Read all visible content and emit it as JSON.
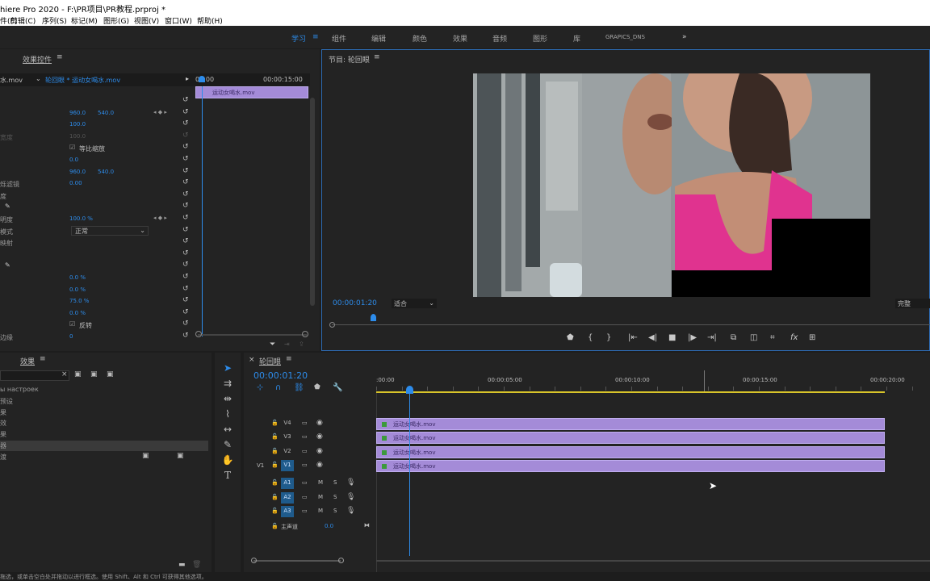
{
  "app": {
    "title": "hiere Pro 2020 - F:\\PR项目\\PR教程.prproj *"
  },
  "menu": [
    "件(F)",
    "剪辑(C)",
    "序列(S)",
    "标记(M)",
    "图形(G)",
    "视图(V)",
    "窗口(W)",
    "帮助(H)"
  ],
  "workspaces": [
    {
      "label": "学习",
      "active": true
    },
    {
      "label": "组件"
    },
    {
      "label": "编辑"
    },
    {
      "label": "颜色"
    },
    {
      "label": "效果"
    },
    {
      "label": "音频"
    },
    {
      "label": "图形"
    },
    {
      "label": "库"
    },
    {
      "label": "GRAPICS_DNS"
    }
  ],
  "effect_controls": {
    "tab": "效果控件",
    "source": "水.mov",
    "clip": "轮回眼 * 运动女喝水.mov",
    "ruler": [
      "00:00",
      "00:00:15:00"
    ],
    "clip_label": "运动女喝水.mov",
    "rows": [
      {
        "label": "",
        "v1": "",
        "v2": ""
      },
      {
        "label": "",
        "v1": "960.0",
        "v2": "540.0",
        "kf": true
      },
      {
        "label": "",
        "v1": "100.0",
        "v2": ""
      },
      {
        "label": "宽度",
        "v1": "100.0",
        "v2": "",
        "dim": true
      },
      {
        "label": "",
        "v1": "",
        "v2": "",
        "check": "等比缩放"
      },
      {
        "label": "",
        "v1": "0.0",
        "v2": ""
      },
      {
        "label": "",
        "v1": "960.0",
        "v2": "540.0"
      },
      {
        "label": "烁滤镜",
        "v1": "0.00",
        "v2": ""
      },
      {
        "label": "度",
        "v1": "",
        "v2": ""
      },
      {
        "label": "",
        "v1": "",
        "v2": "",
        "pen": true
      },
      {
        "label": "明度",
        "v1": "100.0 %",
        "v2": "",
        "kf": true
      },
      {
        "label": "模式",
        "v1": "正常",
        "v2": "",
        "select": true
      },
      {
        "label": "映射",
        "v1": "",
        "v2": ""
      },
      {
        "label": "",
        "v1": "",
        "v2": ""
      },
      {
        "label": "",
        "v1": "",
        "v2": "",
        "pen": true
      },
      {
        "label": "",
        "v1": "0.0 %",
        "v2": ""
      },
      {
        "label": "",
        "v1": "0.0 %",
        "v2": ""
      },
      {
        "label": "",
        "v1": "75.0 %",
        "v2": ""
      },
      {
        "label": "",
        "v1": "0.0 %",
        "v2": ""
      },
      {
        "label": "",
        "v1": "",
        "v2": "",
        "check": "反转"
      },
      {
        "label": "边缘",
        "v1": "0",
        "v2": ""
      }
    ]
  },
  "program": {
    "title": "节目: 轮回眼",
    "timecode": "00:00:01:20",
    "fit": "适合",
    "quality": "完整"
  },
  "effects_panel": {
    "tab": "效果",
    "items": [
      "ы настроек",
      "预设",
      "果",
      "效",
      "果",
      "器",
      "渡"
    ]
  },
  "timeline": {
    "tab": "轮回眼",
    "timecode": "00:00:01:20",
    "ruler": [
      ":00:00",
      "00:00:05:00",
      "00:00:10:00",
      "00:00:15:00",
      "00:00:20:00"
    ],
    "video_tracks": [
      {
        "name": "V4",
        "clip": "运动女喝水.mov"
      },
      {
        "name": "V3",
        "clip": "运动女喝水.mov"
      },
      {
        "name": "V2",
        "clip": "运动女喝水.mov"
      },
      {
        "name": "V1",
        "clip": "运动女喝水.mov",
        "src": "V1"
      }
    ],
    "audio_tracks": [
      "A1",
      "A2",
      "A3"
    ],
    "master": {
      "label": "主声道",
      "value": "0.0"
    }
  },
  "status": "拖选，或单击空白处并拖动以进行框选。使用 Shift、Alt 和 Ctrl 可获得其他选项。",
  "colors": {
    "accent": "#2d8ceb",
    "clip": "#a48bd8",
    "playhead": "#2d8ceb"
  }
}
